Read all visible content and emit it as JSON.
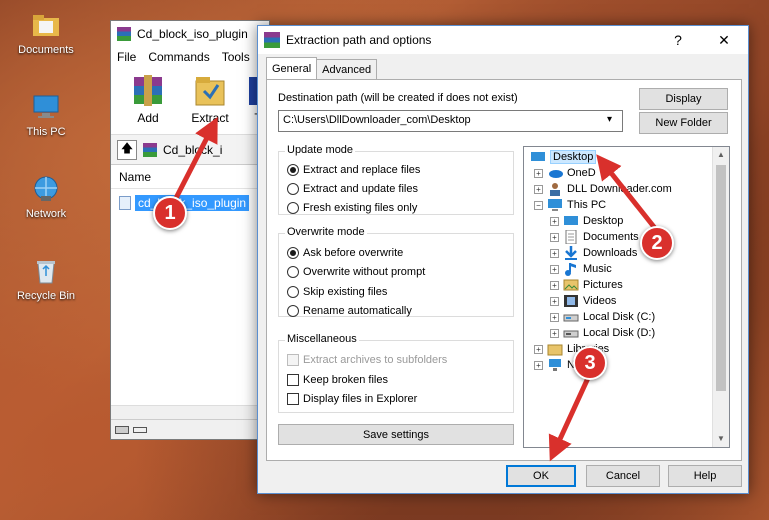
{
  "desktop": {
    "icons": [
      {
        "label": "Documents"
      },
      {
        "label": "This PC"
      },
      {
        "label": "Network"
      },
      {
        "label": "Recycle Bin"
      }
    ]
  },
  "winrar": {
    "title": "Cd_block_iso_plugin",
    "menu": [
      "File",
      "Commands",
      "Tools"
    ],
    "toolbar": {
      "add": "Add",
      "extract_to": "Extract To",
      "third": "T"
    },
    "address": "Cd_block_i",
    "column_name": "Name",
    "file_name": "cd_block_iso_plugin"
  },
  "dialog": {
    "title": "Extraction path and options",
    "help_glyph": "?",
    "close_glyph": "✕",
    "tabs": [
      "General",
      "Advanced"
    ],
    "dest_label": "Destination path (will be created if does not exist)",
    "dest_value": "C:\\Users\\DllDownloader_com\\Desktop",
    "display_btn": "Display",
    "new_folder_btn": "New Folder",
    "update_mode": {
      "title": "Update mode",
      "options": [
        "Extract and replace files",
        "Extract and update files",
        "Fresh existing files only"
      ],
      "selected": 0
    },
    "overwrite_mode": {
      "title": "Overwrite mode",
      "options": [
        "Ask before overwrite",
        "Overwrite without prompt",
        "Skip existing files",
        "Rename automatically"
      ],
      "selected": 0
    },
    "misc": {
      "title": "Miscellaneous",
      "options": [
        "Extract archives to subfolders",
        "Keep broken files",
        "Display files in Explorer"
      ]
    },
    "save_settings": "Save settings",
    "tree": [
      {
        "label": "Desktop",
        "icon": "desktop-icon"
      },
      {
        "label": "OneD",
        "icon": "onedrive-icon"
      },
      {
        "label": "DLL Downloader.com",
        "icon": "user-icon"
      },
      {
        "label": "This PC",
        "icon": "computer-icon"
      },
      {
        "label": "Desktop",
        "icon": "desktop-icon"
      },
      {
        "label": "Documents",
        "icon": "documents-icon"
      },
      {
        "label": "Downloads",
        "icon": "downloads-icon"
      },
      {
        "label": "Music",
        "icon": "music-icon"
      },
      {
        "label": "Pictures",
        "icon": "pictures-icon"
      },
      {
        "label": "Videos",
        "icon": "videos-icon"
      },
      {
        "label": "Local Disk (C:)",
        "icon": "disk-icon"
      },
      {
        "label": "Local Disk (D:)",
        "icon": "disk-icon"
      },
      {
        "label": "Libraries",
        "icon": "libraries-icon"
      },
      {
        "label": "N",
        "icon": "network-icon"
      }
    ],
    "ok": "OK",
    "cancel": "Cancel",
    "help": "Help"
  },
  "markers": [
    "1",
    "2",
    "3"
  ],
  "colors": {
    "marker": "#d9302c",
    "selection": "#3399ff",
    "accent": "#0078d7"
  }
}
